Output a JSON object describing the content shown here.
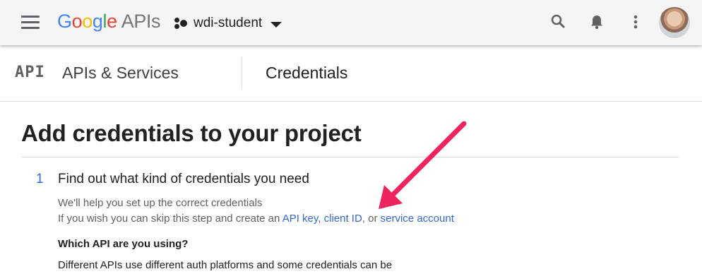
{
  "colors": {
    "google_blue": "#4285f4",
    "google_red": "#ea4335",
    "google_yellow": "#fbbc05",
    "google_green": "#34a853",
    "link_blue": "#3367d6",
    "arrow_pink": "#f0245d"
  },
  "topbar": {
    "menu_icon": "hamburger-menu-icon",
    "logo": {
      "letters": [
        "G",
        "o",
        "o",
        "g",
        "l",
        "e"
      ],
      "suffix": "APIs"
    },
    "project": {
      "icon": "project-dots-icon",
      "name": "wdi-student",
      "dropdown_icon": "caret-down-icon"
    },
    "actions": [
      "search-icon",
      "notifications-bell-icon",
      "more-vert-icon"
    ],
    "avatar": "user-avatar"
  },
  "subheader": {
    "api_mark": "API",
    "section": "APIs & Services",
    "page": "Credentials"
  },
  "main": {
    "heading": "Add credentials to your project",
    "step": {
      "number": "1",
      "title": "Find out what kind of credentials you need",
      "help_line_1": "We'll help you set up the correct credentials",
      "help_line_2_prefix": "If you wish you can skip this step and create an ",
      "link_api_key": "API key",
      "sep_1": ", ",
      "link_client_id": "client ID",
      "sep_2": ", or ",
      "link_service_account": "service account",
      "question": "Which API are you using?",
      "description": "Different APIs use different auth platforms and some credentials can be"
    }
  },
  "annotation": {
    "type": "arrow",
    "points_to": "client ID"
  }
}
